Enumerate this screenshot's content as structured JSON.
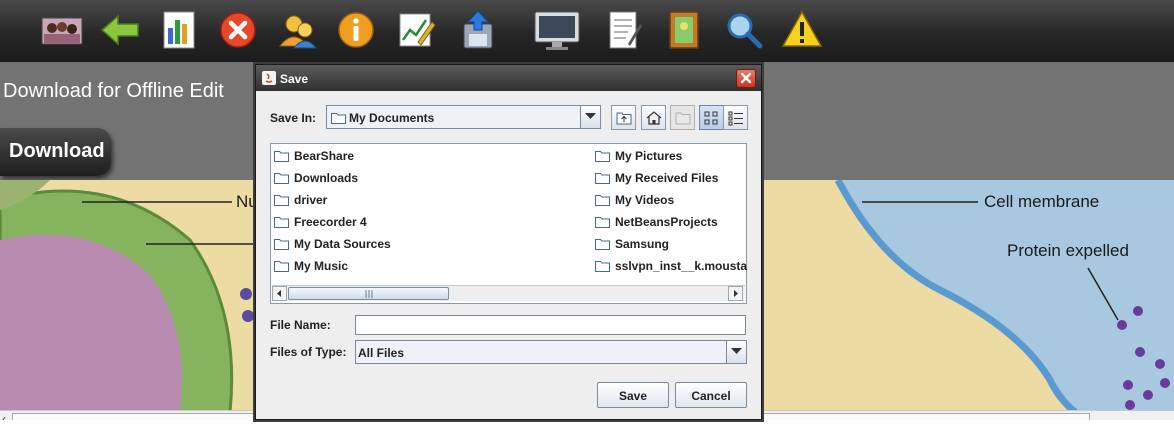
{
  "toolbar": {
    "icons": [
      "photo-icon",
      "back-arrow-icon",
      "chart-icon",
      "close-icon",
      "users-icon",
      "info-icon",
      "edit-chart-icon",
      "upload-icon",
      "monitor-icon",
      "notepad-icon",
      "picture-frame-icon",
      "search-icon",
      "warning-icon"
    ]
  },
  "page": {
    "heading": "Download for Offline Edit",
    "download_label": "Download"
  },
  "diagram": {
    "labels": {
      "nucleus_fragment": "Nu",
      "cell_membrane": "Cell membrane",
      "protein_expelled": "Protein expelled"
    }
  },
  "dialog": {
    "title": "Save",
    "save_in_label": "Save In:",
    "save_in_value": "My Documents",
    "files_col1": [
      "BearShare",
      "Downloads",
      "driver",
      "Freecorder 4",
      "My Data Sources",
      "My Music"
    ],
    "files_col2": [
      "My Pictures",
      "My Received Files",
      "My Videos",
      "NetBeansProjects",
      "Samsung",
      "sslvpn_inst__k.mousta"
    ],
    "file_name_label": "File Name:",
    "file_name_value": "",
    "files_of_type_label": "Files of Type:",
    "files_of_type_value": "All Files",
    "save_button": "Save",
    "cancel_button": "Cancel"
  },
  "colors": {
    "toolbar_bg": "#262626",
    "content_bg": "#737373",
    "dialog_bg": "#eeeeee",
    "diagram_bg": "#ecdca4",
    "membrane_blue": "#5a9ad0",
    "nucleus_green": "#8fbf6a"
  }
}
